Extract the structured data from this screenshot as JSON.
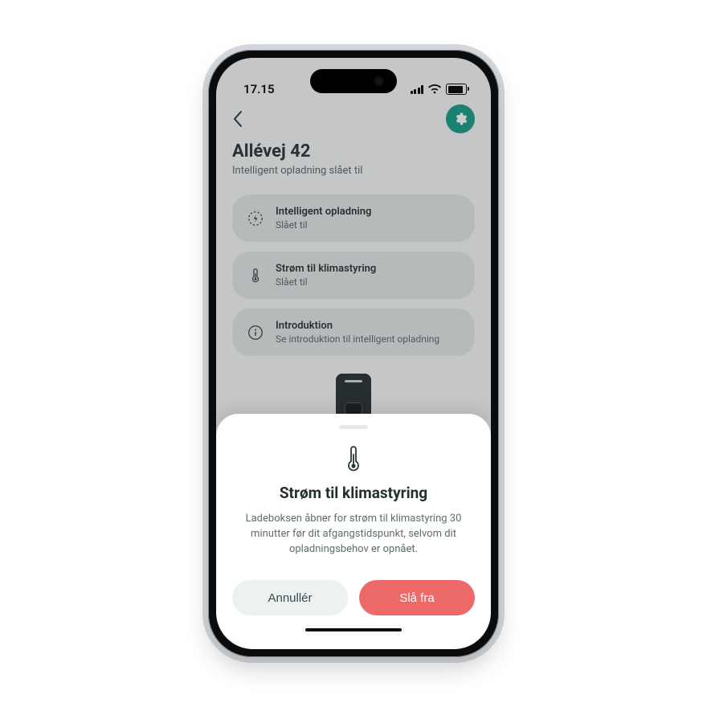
{
  "statusbar": {
    "time": "17.15"
  },
  "header": {
    "title": "Allévej 42",
    "subtitle": "Intelligent opladning slået til"
  },
  "items": [
    {
      "icon": "bolt-circle-icon",
      "title": "Intelligent opladning",
      "subtitle": "Slået til"
    },
    {
      "icon": "thermometer-icon",
      "title": "Strøm til klimastyring",
      "subtitle": "Slået til"
    },
    {
      "icon": "info-icon",
      "title": "Introduktion",
      "subtitle": "Se introduktion til intelligent opladning"
    }
  ],
  "sheet": {
    "title": "Strøm til klimastyring",
    "body": "Ladeboksen åbner for strøm til klimastyring 30 minutter før dit afgangstidspunkt, selvom dit opladningsbehov er opnået.",
    "cancel": "Annullér",
    "confirm": "Slå fra"
  },
  "colors": {
    "accent": "#1e9f8a",
    "danger": "#ee6a6a"
  }
}
